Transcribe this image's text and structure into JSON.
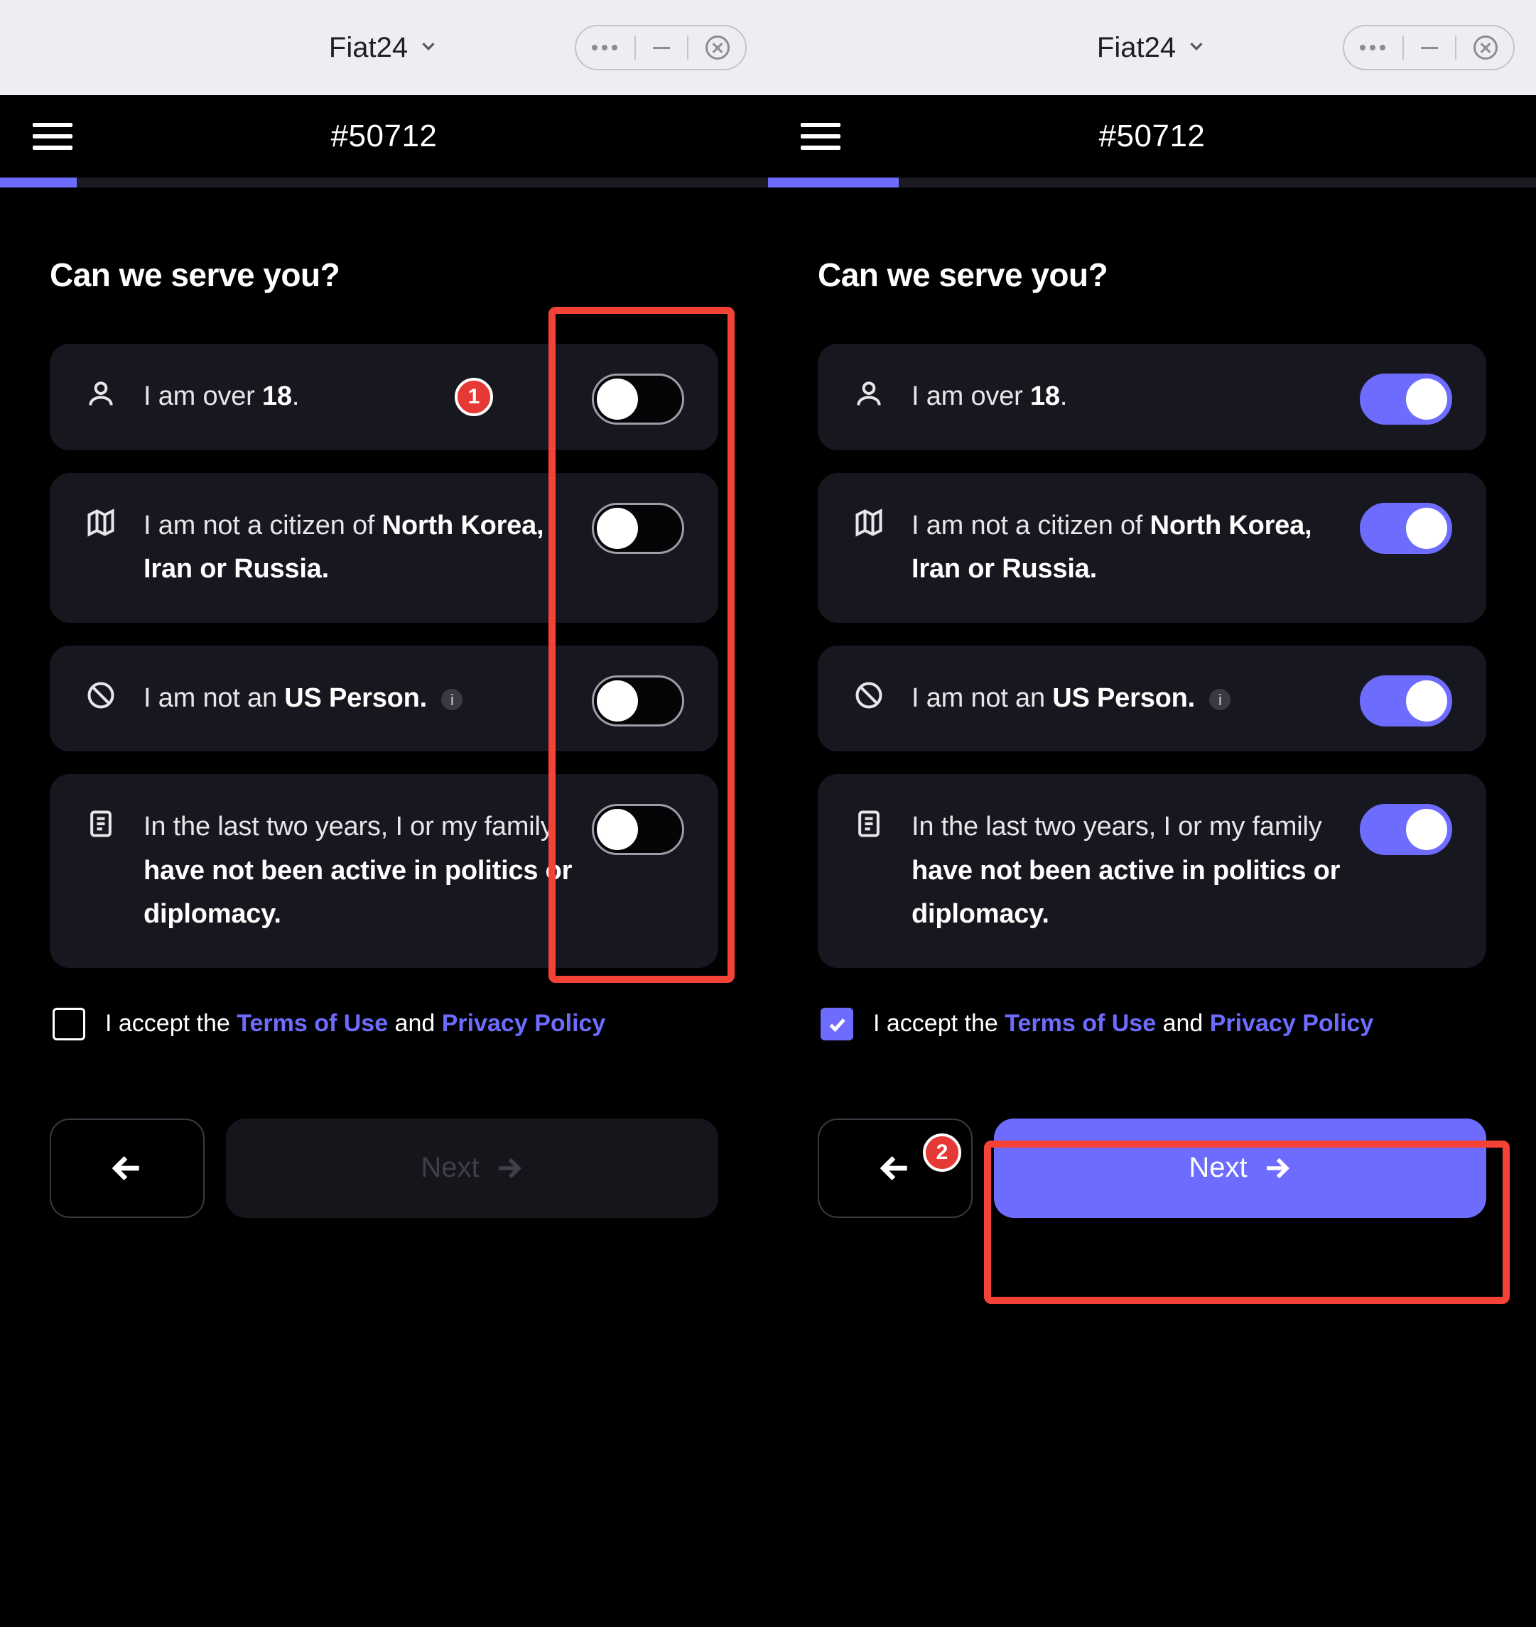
{
  "chrome": {
    "app_name": "Fiat24"
  },
  "header": {
    "id_label": "#50712"
  },
  "left": {
    "progress_pct": 10,
    "title": "Can we serve you?",
    "items": {
      "over18": {
        "text_pre": "I am over ",
        "bold": "18",
        "text_post": ".",
        "on": false
      },
      "citizen": {
        "text_pre": "I am not a citizen of ",
        "bold": "North Korea, Iran or Russia.",
        "on": false
      },
      "usperson": {
        "text_pre": "I am not an ",
        "bold": "US Person.",
        "on": false
      },
      "politics": {
        "text_pre": "In the last two years, I or my family ",
        "bold": "have not been active in politics or diplomacy.",
        "on": false
      }
    },
    "terms": {
      "checked": false,
      "accept": "I accept the ",
      "tou": "Terms of Use",
      "and": " and ",
      "pp": "Privacy Policy"
    },
    "next_label": "Next",
    "annotation_number": "1"
  },
  "right": {
    "progress_pct": 17,
    "title": "Can we serve you?",
    "items": {
      "over18": {
        "text_pre": "I am over ",
        "bold": "18",
        "text_post": ".",
        "on": true
      },
      "citizen": {
        "text_pre": "I am not a citizen of ",
        "bold": "North Korea, Iran or Russia.",
        "on": true
      },
      "usperson": {
        "text_pre": "I am not an ",
        "bold": "US Person.",
        "on": true
      },
      "politics": {
        "text_pre": "In the last two years, I or my family ",
        "bold": "have not been active in politics or diplomacy.",
        "on": true
      }
    },
    "terms": {
      "checked": true,
      "accept": "I accept the ",
      "tou": "Terms of Use",
      "and": " and ",
      "pp": "Privacy Policy"
    },
    "next_label": "Next",
    "annotation_number": "2"
  }
}
